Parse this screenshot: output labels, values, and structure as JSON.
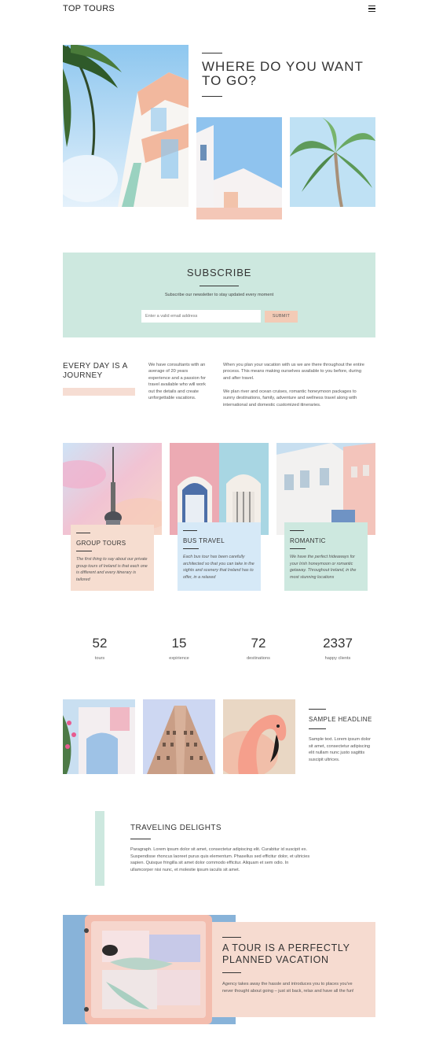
{
  "header": {
    "brand": "TOP TOURS",
    "menu_icon": "hamburger-menu-icon"
  },
  "hero": {
    "title": "WHERE DO YOU WANT TO GO?"
  },
  "subscribe": {
    "title": "SUBSCRIBE",
    "text": "Subscribe our newsletter to stay updated every moment",
    "placeholder": "Enter a valid email address",
    "button": "SUBMIT"
  },
  "journey": {
    "title": "EVERY DAY IS A JOURNEY",
    "col1": "We have consultants with an average of 20 years experience and a passion for travel available who will work out the details and create unforgettable vacations.",
    "col2a": "When you plan your vacation with us we are there throughout the entire process. This means making ourselves available to you before, during and after travel.",
    "col2b": "We plan river and ocean cruises, romantic honeymoon packages to sunny destinations, family, adventure and wellness travel along with international and domestic customized itineraries."
  },
  "cards": [
    {
      "title": "GROUP TOURS",
      "text": "The first thing to say about our private group tours of Ireland is that each one is different and every itinerary is tailored",
      "color": "#f6ddd0"
    },
    {
      "title": "BUS TRAVEL",
      "text": "Each bus tour has been carefully architected so that you can take in the sights and scenery that Ireland has to offer, in a relaxed",
      "color": "#d6e9f7"
    },
    {
      "title": "ROMANTIC",
      "text": "We have the perfect hideaways for your Irish honeymoon or romantic getaway. Throughout Ireland, in the most stunning locations",
      "color": "#cde8df"
    }
  ],
  "stats": [
    {
      "value": "52",
      "label": "tours"
    },
    {
      "value": "15",
      "label": "expirience"
    },
    {
      "value": "72",
      "label": "destinations"
    },
    {
      "value": "2337",
      "label": "happy clients"
    }
  ],
  "sample": {
    "title": "SAMPLE HEADLINE",
    "text": "Sample text. Lorem ipsum dolor sit amet, consectetur adipiscing elit nullam nunc justo sagittis suscipit ultrices."
  },
  "traveling": {
    "title": "TRAVELING DELIGHTS",
    "text": "Paragraph. Lorem ipsum dolor sit amet, consectetur adipiscing elit. Curabitur id suscipit ex. Suspendisse rhoncus laoreet purus quis elementum. Phasellus sed efficitur dolor, et ultricies sapien. Quisque fringilla sit amet dolor commodo efficitur. Aliquam et sem odio. In ullamcorper nisi nunc, et molestie ipsum iaculis sit amet."
  },
  "tour": {
    "title": "A TOUR IS A PERFECTLY PLANNED VACATION",
    "text": "Agency takes away the hassle and introduces you to places you've never thought about going – just sit back, relax and have all the fun!"
  },
  "colors": {
    "mint": "#cde8df",
    "peach": "#f6ddd0",
    "sky": "#d6e9f7",
    "button": "#f3cbb6"
  }
}
